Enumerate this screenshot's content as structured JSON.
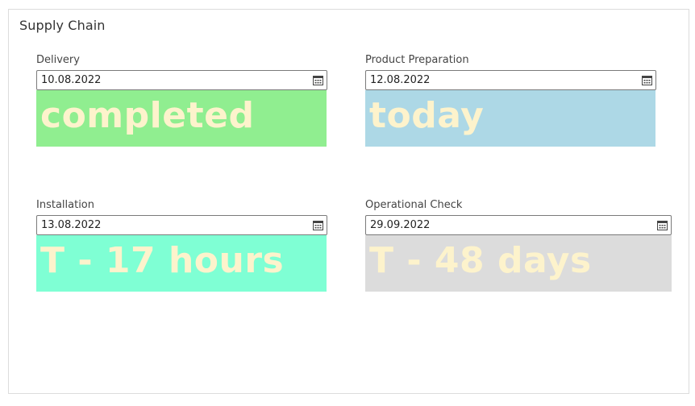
{
  "panel": {
    "title": "Supply Chain"
  },
  "fields": [
    {
      "label": "Delivery",
      "date": "10.08.2022",
      "status": "completed",
      "color": "#90ee90"
    },
    {
      "label": "Product Preparation",
      "date": "12.08.2022",
      "status": "today",
      "color": "#add8e6"
    },
    {
      "label": "Installation",
      "date": "13.08.2022",
      "status": "T - 17 hours",
      "color": "#7fffd4"
    },
    {
      "label": "Operational Check",
      "date": "29.09.2022",
      "status": "T - 48 days",
      "color": "#dcdcdc"
    }
  ],
  "icons": {
    "date_picker": "calendar-icon"
  },
  "colors": {
    "status_text": "#fdf3cc",
    "border": "#dcdcdc"
  }
}
